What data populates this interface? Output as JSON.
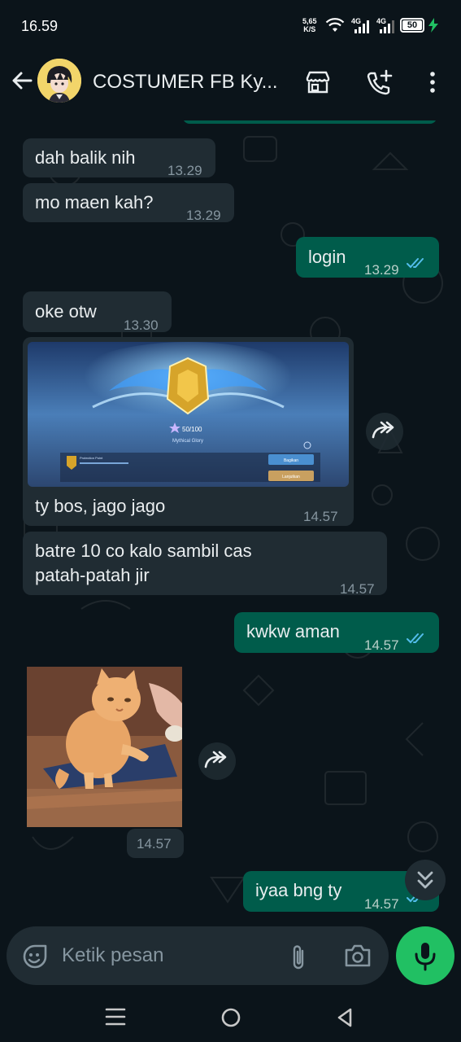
{
  "status_bar": {
    "time": "16.59",
    "net_speed_value": "5,65",
    "net_speed_unit": "K/S",
    "battery": "50",
    "battery_level_percent": 50
  },
  "header": {
    "contact_name": "COSTUMER FB Ky..."
  },
  "messages": [
    {
      "direction": "in",
      "text": "dah balik nih",
      "time": "13.29"
    },
    {
      "direction": "in",
      "text": "mo maen kah?",
      "time": "13.29"
    },
    {
      "direction": "out",
      "text": "login",
      "time": "13.29",
      "status": "read"
    },
    {
      "direction": "in",
      "text": "oke otw",
      "time": "13.30"
    },
    {
      "direction": "in",
      "type": "image",
      "image": {
        "stars": "50/100",
        "rank": "Mythical Glory",
        "protection_label": "Protection Point",
        "button_top": "Bagikan",
        "button_bottom": "Lanjutkan"
      },
      "caption": "ty bos, jago jago",
      "time": "14.57"
    },
    {
      "direction": "in",
      "text_line1": "batre 10 co kalo sambil cas",
      "text_line2": "patah-patah jir",
      "time": "14.57"
    },
    {
      "direction": "out",
      "text": "kwkw aman",
      "time": "14.57",
      "status": "read"
    },
    {
      "direction": "in",
      "type": "image",
      "image_subject": "cat",
      "time": "14.57"
    },
    {
      "direction": "out",
      "text": "iyaa bng ty",
      "time": "14.57",
      "status": "read"
    }
  ],
  "composer": {
    "placeholder": "Ketik pesan"
  },
  "colors": {
    "background": "#0b141a",
    "incoming_bubble": "#202c33",
    "outgoing_bubble": "#005c4b",
    "read_ticks": "#53bdeb",
    "mic_button": "#21c063"
  }
}
